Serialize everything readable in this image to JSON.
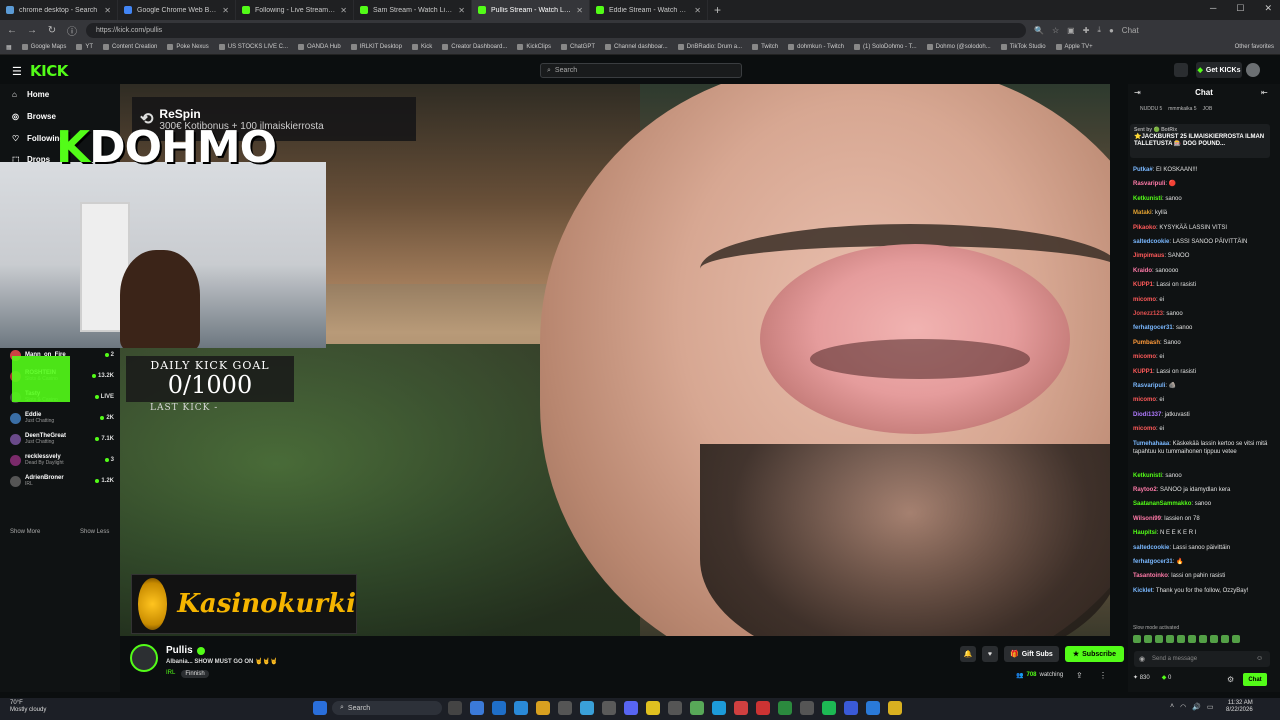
{
  "browser": {
    "tabs": [
      {
        "label": "chrome desktop - Search",
        "color": "#5b9bd5"
      },
      {
        "label": "Google Chrome Web Browser: Fir",
        "color": "#4285f4"
      },
      {
        "label": "Following - Live Streams on Kick",
        "color": "#53fc18"
      },
      {
        "label": "Sam Stream - Watch Live on K",
        "color": "#53fc18"
      },
      {
        "label": "Pullis Stream - Watch Live on",
        "color": "#53fc18",
        "active": true
      },
      {
        "label": "Eddie Stream - Watch Live on Kick",
        "color": "#53fc18"
      }
    ],
    "new_tab": "+",
    "url": "https://kick.com/pullis",
    "bookmarks": [
      "Google Maps",
      "YT",
      "Content Creation",
      "Poke Nexus",
      "US STOCKS LIVE C...",
      "OANDA Hub",
      "IRLKIT Desktop",
      "Kick",
      "Creator Dashboard...",
      "KickClips",
      "ChatGPT",
      "Channel dashboar...",
      "DnBRadio: Drum a...",
      "Twitch",
      "dohmkun - Twitch",
      "(1) SoloDohmo - T...",
      "Dohmo (@solodoh...",
      "TikTok Studio",
      "Apple TV+"
    ],
    "other_favorites": "Other favorites",
    "chat_label": "Chat"
  },
  "kick": {
    "logo": "KICK",
    "search_placeholder": "Search",
    "get_kicks": "Get KICKs",
    "accent": "#53fc18"
  },
  "sidebar": {
    "nav": [
      "Home",
      "Browse",
      "Following",
      "Drops"
    ],
    "channels": [
      {
        "name": "Mann_on_Fire",
        "category": "",
        "viewers": "2",
        "color": "#c44"
      },
      {
        "name": "ROSHTEIN",
        "category": "Slots & Casino",
        "viewers": "13.2K",
        "color": "#a33"
      },
      {
        "name": "Tasty",
        "category": "Slots & Casino",
        "viewers": "LIVE",
        "color": "#444"
      },
      {
        "name": "Eddie",
        "category": "Just Chatting",
        "viewers": "2K",
        "color": "#3a6ea5"
      },
      {
        "name": "DeenTheGreat",
        "category": "Just Chatting",
        "viewers": "7.1K",
        "color": "#6a4a8a"
      },
      {
        "name": "recklessvely",
        "category": "Dead By Daylight",
        "viewers": "3",
        "color": "#7a2a6a"
      },
      {
        "name": "AdrienBroner",
        "category": "IRL",
        "viewers": "1.2K",
        "color": "#555"
      }
    ],
    "show_more": "Show More",
    "show_less": "Show Less"
  },
  "overlay": {
    "respin_logo": "ReSpin",
    "respin_title": "ReSpin",
    "respin_sub": "300€ Kotibonus + 100 ilmaiskierrosta",
    "streamer_k": "K",
    "streamer_tag": "DOHMO",
    "goal_label": "DAILY KICK GOAL",
    "goal_value": "0/1000",
    "last_kick": "LAST KICK -",
    "kasino": "Kasinokurki"
  },
  "channel": {
    "name": "Pullis",
    "title": "Albania... SHOW MUST GO ON 🤘🤘🤘",
    "category": "IRL",
    "tag": "Finnish",
    "watching_count": "708",
    "watching_label": "watching"
  },
  "controls": {
    "gift_subs": "Gift Subs",
    "subscribe": "Subscribe"
  },
  "chat": {
    "title": "Chat",
    "kickers": [
      "NUDDU 5",
      "mmmkaika 5",
      "JOB"
    ],
    "pinned_sender": "Sent by 🟢 BotRix",
    "pinned_text": "⭐JACKBURST 25 ILMAISKIERROSTA ILMAN TALLETUSTA 🎰 DOG POUND...",
    "messages": [
      {
        "user": "Putka#",
        "text": "EI KOSKAAN!!!",
        "color": "#7ab8ff"
      },
      {
        "user": "Rasvaripuli",
        "text": "🔴",
        "color": "#ff7aa8"
      },
      {
        "user": "Ketkunisti",
        "text": "sanoo",
        "color": "#53fc18"
      },
      {
        "user": "Mataki",
        "text": "kyllä",
        "color": "#e0a030"
      },
      {
        "user": "Pikaoko",
        "text": "KYSYKÄÄ LASSIN VITSI",
        "color": "#ff5a5a"
      },
      {
        "user": "saltedcookie",
        "text": "LASSI SANOO PÄIVITTÄIN",
        "color": "#7ab8ff"
      },
      {
        "user": "Jimpimaus",
        "text": "SANOO",
        "color": "#ff5a5a"
      },
      {
        "user": "Kraido",
        "text": "sanoooo",
        "color": "#ff7aa8"
      },
      {
        "user": "KUPP1",
        "text": "Lassi on rasisti",
        "color": "#ff5a5a"
      },
      {
        "user": "micomo",
        "text": "ei",
        "color": "#ff5a5a"
      },
      {
        "user": "Jonezz123",
        "text": "sanoo",
        "color": "#e05050"
      },
      {
        "user": "ferhatgocer31",
        "text": "sanoo",
        "color": "#7ab8ff"
      },
      {
        "user": "Pumbash",
        "text": "Sanoo",
        "color": "#ff9a3a"
      },
      {
        "user": "micomo",
        "text": "ei",
        "color": "#ff5a5a"
      },
      {
        "user": "KUPP1",
        "text": "Lassi on rasisti",
        "color": "#ff5a5a"
      },
      {
        "user": "Rasvaripuli",
        "text": "🪨",
        "color": "#7ab8ff"
      },
      {
        "user": "micomo",
        "text": "ei",
        "color": "#ff5a5a"
      },
      {
        "user": "Diodi1337",
        "text": "jatkuvasti",
        "color": "#b07aff"
      },
      {
        "user": "micomo",
        "text": "ei",
        "color": "#ff5a5a"
      },
      {
        "user": "Tumehahaaa",
        "text": "Käskekää lassin kertoo se vitsi mitä tapahtuu ku tummaihonen tippuu vetee",
        "color": "#7ab8ff"
      },
      {
        "user": "Ketkunisti",
        "text": "sanoo",
        "color": "#53fc18"
      },
      {
        "user": "Raytoo2",
        "text": "SANOO ja idamydlan kera",
        "color": "#ff7aa8"
      },
      {
        "user": "SaatananSammakko",
        "text": "sanoo",
        "color": "#53fc18"
      },
      {
        "user": "Wilsoni99",
        "text": "lassien on 78",
        "color": "#ff7aa8"
      },
      {
        "user": "Haupitsi",
        "text": "N E E K E R I",
        "color": "#53fc18"
      },
      {
        "user": "saltedcookie",
        "text": "Lassi sanoo päivittäin",
        "color": "#7ab8ff"
      },
      {
        "user": "ferhatgocer31",
        "text": "🔥",
        "color": "#7ab8ff"
      },
      {
        "user": "Tasantoinko",
        "text": "lassi on pahin rasisti",
        "color": "#ff7aa8"
      },
      {
        "user": "Kicklet",
        "text": "Thank you for the follow, OzzyBay!",
        "color": "#7ab8ff"
      }
    ],
    "slow_mode": "Slow mode activated",
    "input_placeholder": "Send a message",
    "points": "830",
    "kicks": "0",
    "chat_button": "Chat"
  },
  "taskbar": {
    "temp": "70°F",
    "weather": "Mostly cloudy",
    "search": "Search",
    "time": "11:32 AM",
    "date": "8/22/2026"
  }
}
